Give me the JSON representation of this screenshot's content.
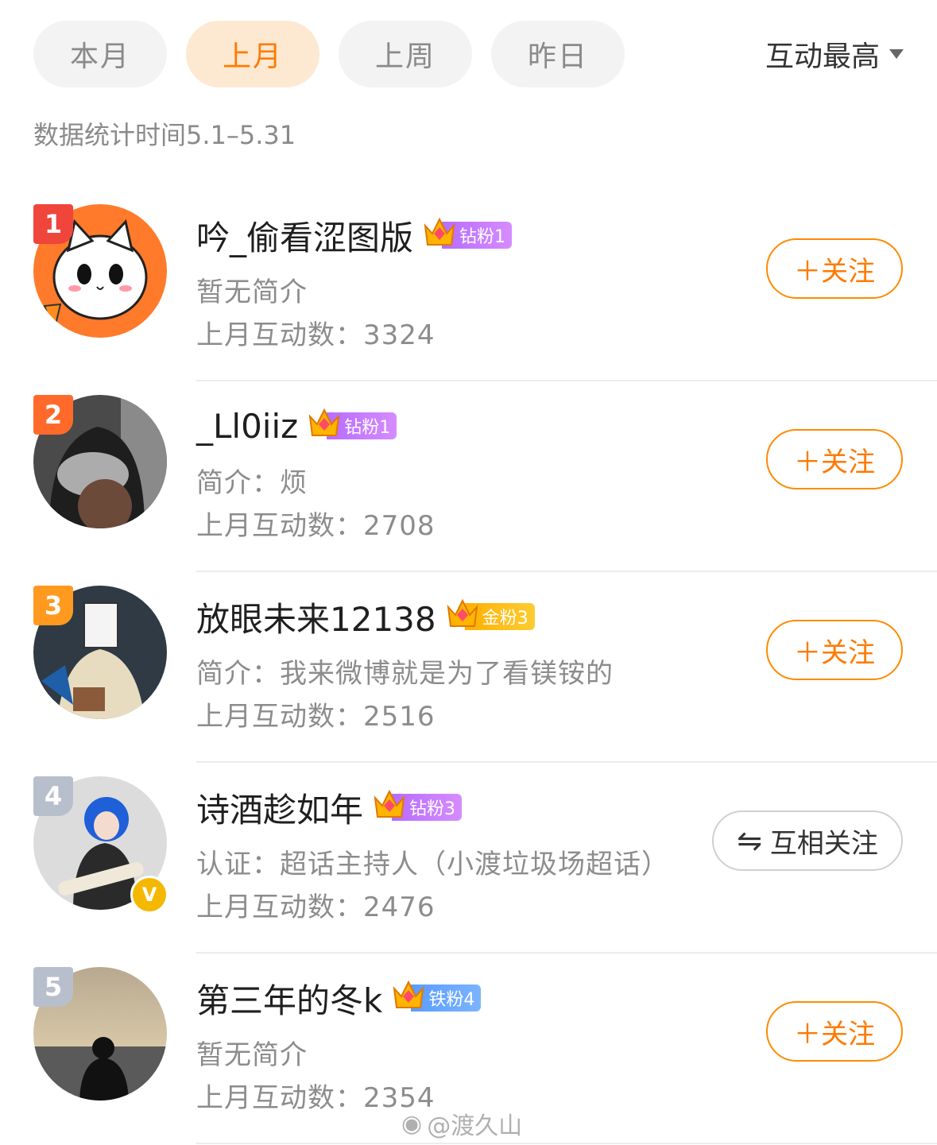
{
  "tabs": [
    {
      "label": "本月",
      "active": false
    },
    {
      "label": "上月",
      "active": true
    },
    {
      "label": "上周",
      "active": false
    },
    {
      "label": "昨日",
      "active": false
    }
  ],
  "sort": {
    "label": "互动最高",
    "icon": "caret-down-icon"
  },
  "stat_range": "数据统计时间5.1–5.31",
  "colors": {
    "accent": "#ff7a00",
    "accent_bg": "#fde9d2",
    "rank1": "#f0453a",
    "rank2": "#ff6a2b",
    "rank3": "#ff9a1f",
    "rank_other": "#b8bfcc"
  },
  "users": [
    {
      "rank": "1",
      "name": "吟_偷看涩图版",
      "fan_level": "钻粉1",
      "crown_num": "4",
      "bio": "暂无简介",
      "count": "上月互动数：3324",
      "button": "＋关注",
      "verified": false
    },
    {
      "rank": "2",
      "name": "_Ll0iiz",
      "fan_level": "钻粉1",
      "crown_num": "6",
      "bio": "简介：烦",
      "count": "上月互动数：2708",
      "button": "＋关注",
      "verified": false
    },
    {
      "rank": "3",
      "name": "放眼未来12138",
      "fan_level": "金粉3",
      "crown_num": "6",
      "bio": "简介：我来微博就是为了看镁铵的",
      "count": "上月互动数：2516",
      "button": "＋关注",
      "verified": false
    },
    {
      "rank": "4",
      "name": "诗酒趁如年",
      "fan_level": "钻粉3",
      "crown_num": "6",
      "bio": "认证：超话主持人（小渡垃圾场超话）",
      "count": "上月互动数：2476",
      "button": "互相关注",
      "verified": true,
      "verified_label": "V"
    },
    {
      "rank": "5",
      "name": "第三年的冬k",
      "fan_level": "铁粉4",
      "crown_num": "1",
      "bio": "暂无简介",
      "count": "上月互动数：2354",
      "button": "＋关注",
      "verified": false
    }
  ],
  "watermark": "@渡久山"
}
